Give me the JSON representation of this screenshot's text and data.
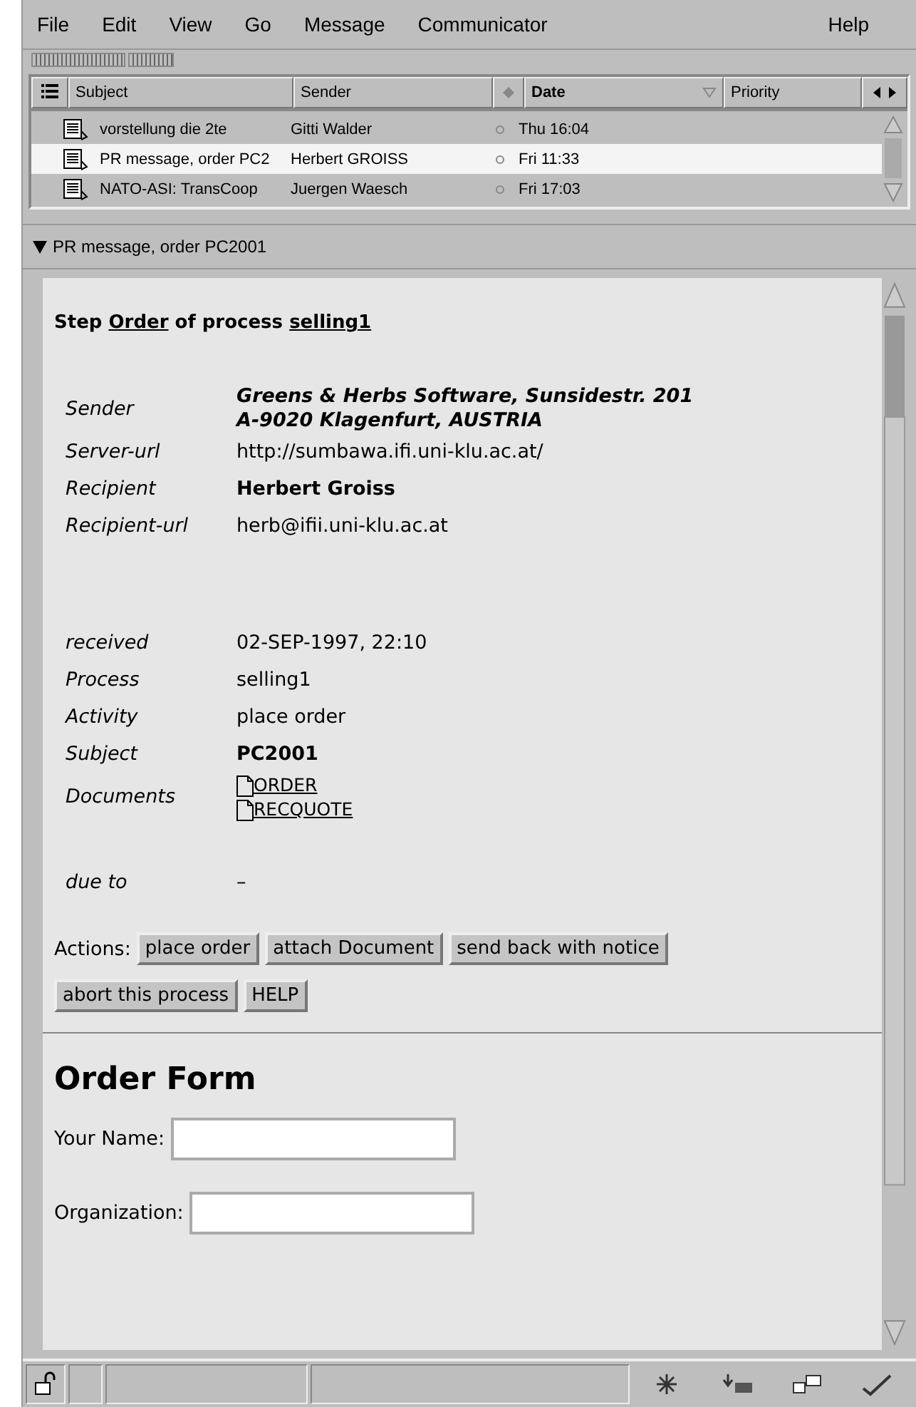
{
  "menu": [
    "File",
    "Edit",
    "View",
    "Go",
    "Message",
    "Communicator"
  ],
  "help_menu": "Help",
  "message_list": {
    "columns": [
      {
        "label": "Subject",
        "sorted": false
      },
      {
        "label": "Sender",
        "sorted": false
      },
      {
        "label": "Date",
        "sorted": true
      },
      {
        "label": "Priority",
        "sorted": false
      }
    ],
    "rows": [
      {
        "subject": "vorstellung die 2te",
        "sender": "Gitti Walder",
        "date": "Thu 16:04",
        "selected": false
      },
      {
        "subject": "PR message, order PC2",
        "sender": "Herbert GROISS",
        "date": "Fri 11:33",
        "selected": true
      },
      {
        "subject": "NATO-ASI: TransCoop",
        "sender": "Juergen Waesch",
        "date": "Fri 17:03",
        "selected": false
      }
    ]
  },
  "message_header": {
    "expanded": true,
    "subject": "PR message, order PC2001"
  },
  "step_title": [
    {
      "kind": "text",
      "text": "Step"
    },
    {
      "kind": "link",
      "text": "Order"
    },
    {
      "kind": "text",
      "text": "of process"
    },
    {
      "kind": "link",
      "text": "selling1"
    }
  ],
  "field_groups": [
    [
      {
        "label": "Sender",
        "kind": "address",
        "lines": [
          "Greens & Herbs Software, Sunsidestr. 201",
          "A-9020 Klagenfurt, AUSTRIA"
        ]
      },
      {
        "label": "Server-url",
        "kind": "text",
        "value": "http://sumbawa.ifi.uni-klu.ac.at/"
      },
      {
        "label": "Recipient",
        "kind": "bold",
        "value": "Herbert Groiss"
      },
      {
        "label": "Recipient-url",
        "kind": "text",
        "value": "herb@ifii.uni-klu.ac.at"
      }
    ],
    [
      {
        "label": "received",
        "kind": "text",
        "value": "02-SEP-1997, 22:10"
      },
      {
        "label": "Process",
        "kind": "text",
        "value": "selling1"
      },
      {
        "label": "Activity",
        "kind": "text",
        "value": "place order"
      },
      {
        "label": "Subject",
        "kind": "bold",
        "value": "PC2001"
      },
      {
        "label": "Documents",
        "kind": "documents",
        "lines": [
          "ORDER",
          "RECQUOTE"
        ]
      }
    ],
    [
      {
        "label": "due to",
        "kind": "text",
        "value": "–"
      }
    ]
  ],
  "actions": {
    "label": "Actions:",
    "buttons": [
      "place order",
      "attach Document",
      "send back with notice",
      "abort this process",
      "HELP"
    ]
  },
  "order_form": {
    "title": "Order Form",
    "fields": [
      {
        "label": "Your Name:"
      },
      {
        "label": "Organization:"
      }
    ]
  }
}
